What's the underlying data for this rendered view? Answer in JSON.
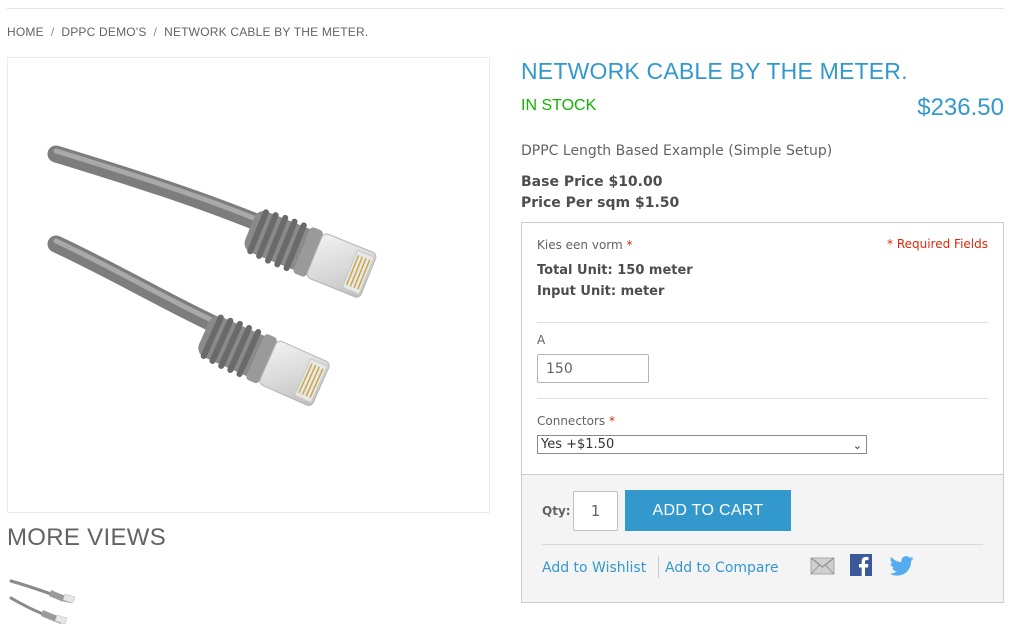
{
  "breadcrumb": {
    "home": "HOME",
    "category": "DPPC DEMO'S",
    "current": "NETWORK CABLE BY THE METER.",
    "separator": "/"
  },
  "product": {
    "name": "NETWORK CABLE BY THE METER.",
    "stock": "IN STOCK",
    "price": "$236.50",
    "short_description": "DPPC Length Based Example (Simple Setup)",
    "base_price": "Base Price $10.00",
    "price_per_sqm": "Price Per sqm $1.50"
  },
  "gallery": {
    "more_views": "MORE VIEWS"
  },
  "options": {
    "shape_label": "Kies een vorm",
    "required_mark": "*",
    "required_fields": "* Required Fields",
    "total_unit": "Total Unit: 150 meter",
    "input_unit": "Input Unit: meter",
    "a_label": "A",
    "a_value": "150",
    "connectors_label": "Connectors",
    "connectors_selected": "Yes +$1.50"
  },
  "cart": {
    "qty_label": "Qty:",
    "qty_value": "1",
    "add_to_cart": "ADD TO CART",
    "wishlist": "Add to Wishlist",
    "compare": "Add to Compare"
  },
  "share": {
    "icons": [
      "email-icon",
      "facebook-icon",
      "twitter-icon"
    ]
  },
  "colors": {
    "accent": "#3399cc",
    "in_stock": "#11b400",
    "required": "#df280a",
    "cable_gray": "#8e8e8e"
  }
}
